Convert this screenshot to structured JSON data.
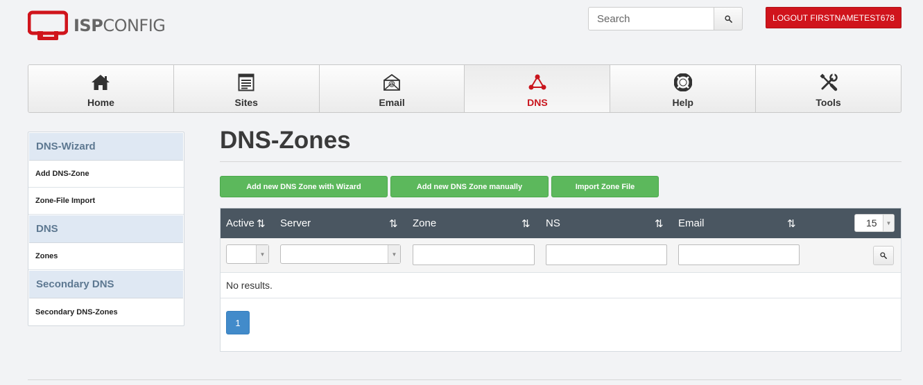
{
  "header": {
    "logo_text_bold": "ISP",
    "logo_text_light": "CONFIG",
    "logo_icon": "isp-monitor-logo",
    "search_placeholder": "Search",
    "search_icon": "search-icon",
    "logout_label": "LOGOUT FIRSTNAMETEST678"
  },
  "nav": {
    "items": [
      {
        "label": "Home",
        "icon": "home-icon"
      },
      {
        "label": "Sites",
        "icon": "sites-icon"
      },
      {
        "label": "Email",
        "icon": "email-icon"
      },
      {
        "label": "DNS",
        "icon": "dns-icon",
        "active": true
      },
      {
        "label": "Help",
        "icon": "help-icon"
      },
      {
        "label": "Tools",
        "icon": "tools-icon"
      }
    ]
  },
  "sidebar": {
    "groups": [
      {
        "heading": "DNS-Wizard",
        "links": [
          "Add DNS-Zone",
          "Zone-File Import"
        ]
      },
      {
        "heading": "DNS",
        "links": [
          "Zones"
        ]
      },
      {
        "heading": "Secondary DNS",
        "links": [
          "Secondary DNS-Zones"
        ]
      }
    ]
  },
  "main": {
    "title": "DNS-Zones",
    "actions": [
      "Add new DNS Zone with Wizard",
      "Add new DNS Zone manually",
      "Import Zone File"
    ],
    "table": {
      "columns": [
        "Active",
        "Server",
        "Zone",
        "NS",
        "Email"
      ],
      "sort_glyph": "⇅",
      "page_size": "15",
      "empty_text": "No results.",
      "pages": [
        "1"
      ]
    }
  },
  "colors": {
    "brand_red": "#d0141c",
    "action_green": "#5cb85c",
    "table_header": "#4a5661",
    "pager_blue": "#428bca"
  }
}
